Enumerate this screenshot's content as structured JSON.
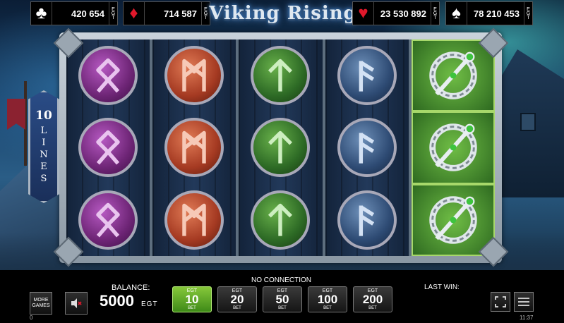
{
  "jackpots": [
    {
      "suit": "♣",
      "suit_name": "clubs",
      "value": "420 654",
      "currency": "EGT",
      "color": "#ffffff"
    },
    {
      "suit": "♦",
      "suit_name": "diamonds",
      "value": "714 587",
      "currency": "EGT",
      "color": "#e0182b"
    },
    {
      "suit": "♥",
      "suit_name": "hearts",
      "value": "23 530 892",
      "currency": "EGT",
      "color": "#e0182b"
    },
    {
      "suit": "♠",
      "suit_name": "spades",
      "value": "78 210 453",
      "currency": "EGT",
      "color": "#ffffff"
    }
  ],
  "game": {
    "title": "Viking Rising"
  },
  "lines_badge": {
    "number": "10",
    "word": "LINES"
  },
  "reels": [
    {
      "symbol": "othala-rune",
      "color": "purple"
    },
    {
      "symbol": "mannaz-rune",
      "color": "red"
    },
    {
      "symbol": "tiwaz-rune",
      "color": "green"
    },
    {
      "symbol": "ansuz-rune",
      "color": "blue"
    },
    {
      "symbol": "celtic-brooch",
      "color": "silver",
      "highlighted": true
    }
  ],
  "bottom": {
    "more_games": "MORE GAMES",
    "balance_label": "BALANCE:",
    "balance_value": "5000",
    "balance_currency": "EGT",
    "status": "NO CONNECTION",
    "bets": [
      {
        "egt": "EGT",
        "amount": "10",
        "label": "BET",
        "active": true
      },
      {
        "egt": "EGT",
        "amount": "20",
        "label": "BET",
        "active": false
      },
      {
        "egt": "EGT",
        "amount": "50",
        "label": "BET",
        "active": false
      },
      {
        "egt": "EGT",
        "amount": "100",
        "label": "BET",
        "active": false
      },
      {
        "egt": "EGT",
        "amount": "200",
        "label": "BET",
        "active": false
      }
    ],
    "last_win_label": "LAST WIN:",
    "credit_counter": "0",
    "clock": "11:37"
  },
  "colors": {
    "active_bet": "#5fae28",
    "brooch_highlight": "#5aa33a"
  }
}
